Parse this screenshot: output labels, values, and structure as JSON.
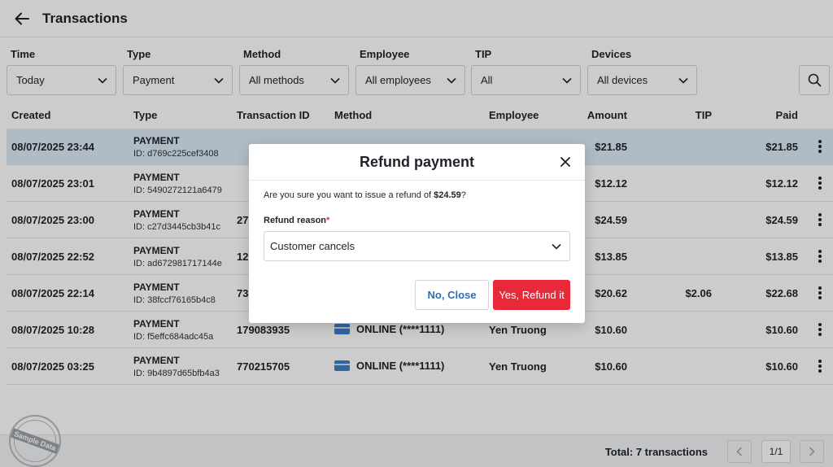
{
  "header": {
    "title": "Transactions",
    "back_icon": "arrow-left-icon"
  },
  "filters": [
    {
      "label": "Time",
      "value": "Today"
    },
    {
      "label": "Type",
      "value": "Payment"
    },
    {
      "label": "Method",
      "value": "All methods"
    },
    {
      "label": "Employee",
      "value": "All employees"
    },
    {
      "label": "TIP",
      "value": "All"
    },
    {
      "label": "Devices",
      "value": "All devices"
    }
  ],
  "table": {
    "columns": [
      "Created",
      "Type",
      "Transaction ID",
      "Method",
      "Employee",
      "Amount",
      "TIP",
      "Paid"
    ],
    "rows": [
      {
        "created": "08/07/2025 23:44",
        "type": "PAYMENT",
        "id": "ID:  d769c225cef3408",
        "txid": "",
        "method": "",
        "employee": "",
        "amount": "$21.85",
        "tip": "",
        "paid": "$21.85"
      },
      {
        "created": "08/07/2025 23:01",
        "type": "PAYMENT",
        "id": "ID:  5490272121a6479",
        "txid": "",
        "method": "",
        "employee": "",
        "amount": "$12.12",
        "tip": "",
        "paid": "$12.12"
      },
      {
        "created": "08/07/2025 23:00",
        "type": "PAYMENT",
        "id": "ID:  c27d3445cb3b41c",
        "txid": "27",
        "method": "",
        "employee": "",
        "amount": "$24.59",
        "tip": "",
        "paid": "$24.59"
      },
      {
        "created": "08/07/2025 22:52",
        "type": "PAYMENT",
        "id": "ID:  ad672981717144e",
        "txid": "12",
        "method": "",
        "employee": "",
        "amount": "$13.85",
        "tip": "",
        "paid": "$13.85"
      },
      {
        "created": "08/07/2025 22:14",
        "type": "PAYMENT",
        "id": "ID:  38fccf76165b4c8",
        "txid": "73",
        "method": "",
        "employee": "",
        "amount": "$20.62",
        "tip": "$2.06",
        "paid": "$22.68"
      },
      {
        "created": "08/07/2025 10:28",
        "type": "PAYMENT",
        "id": "ID:  f5effc684adc45a",
        "txid": "179083935",
        "method": "ONLINE (****1111)",
        "employee": "Yen Truong",
        "amount": "$10.60",
        "tip": "",
        "paid": "$10.60"
      },
      {
        "created": "08/07/2025 03:25",
        "type": "PAYMENT",
        "id": "ID:  9b4897d65bfb4a3",
        "txid": "770215705",
        "method": "ONLINE (****1111)",
        "employee": "Yen Truong",
        "amount": "$10.60",
        "tip": "",
        "paid": "$10.60"
      }
    ]
  },
  "footer": {
    "total": "Total: 7 transactions",
    "page": "1/1"
  },
  "stamp": {
    "text": "Sample Data"
  },
  "modal": {
    "title": "Refund payment",
    "question_prefix": "Are you sure you want to issue a refund of ",
    "question_amount": "$24.59",
    "question_suffix": "?",
    "reason_label": "Refund reason",
    "required_mark": "*",
    "reason_value": "Customer cancels",
    "cancel_label": "No, Close",
    "confirm_label": "Yes, Refund it"
  },
  "colors": {
    "accent_red": "#e8293a",
    "link_blue": "#2f6db5",
    "row_highlight": "#dcebf7",
    "card_blue": "#3c7fc8"
  }
}
